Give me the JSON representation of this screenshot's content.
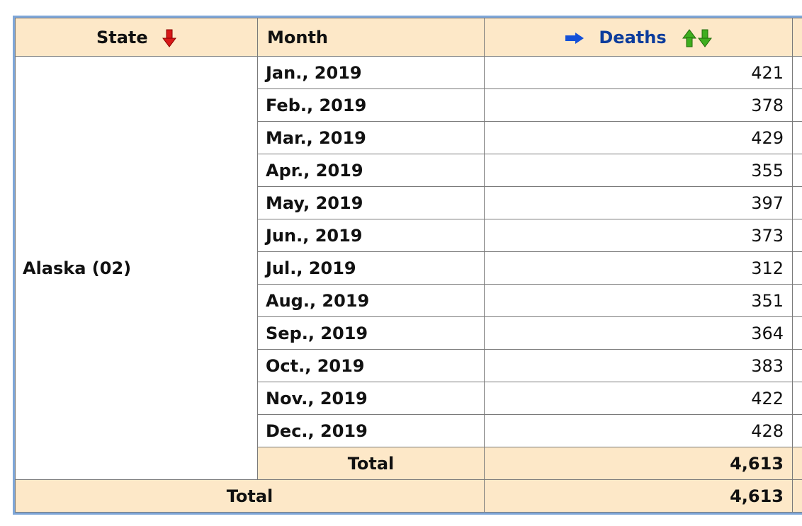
{
  "header": {
    "state": "State",
    "month": "Month",
    "deaths": "Deaths"
  },
  "icons": {
    "state_sort": "red-down-arrow-icon",
    "deaths_indicator": "blue-right-arrow-icon",
    "deaths_sort": "green-up-down-arrows-icon"
  },
  "colors": {
    "header_bg": "#fde8c8",
    "border_frame": "#7ea6d8",
    "deaths_header_text": "#0c3c9c",
    "sort_down_red": "#d81818",
    "sort_green": "#3fae1f",
    "indicator_blue": "#1450d8"
  },
  "state_label": "Alaska (02)",
  "rows": [
    {
      "month": "Jan., 2019",
      "deaths": "421"
    },
    {
      "month": "Feb., 2019",
      "deaths": "378"
    },
    {
      "month": "Mar., 2019",
      "deaths": "429"
    },
    {
      "month": "Apr., 2019",
      "deaths": "355"
    },
    {
      "month": "May, 2019",
      "deaths": "397"
    },
    {
      "month": "Jun., 2019",
      "deaths": "373"
    },
    {
      "month": "Jul., 2019",
      "deaths": "312"
    },
    {
      "month": "Aug., 2019",
      "deaths": "351"
    },
    {
      "month": "Sep., 2019",
      "deaths": "364"
    },
    {
      "month": "Oct., 2019",
      "deaths": "383"
    },
    {
      "month": "Nov., 2019",
      "deaths": "422"
    },
    {
      "month": "Dec., 2019",
      "deaths": "428"
    }
  ],
  "subtotal": {
    "label": "Total",
    "value": "4,613"
  },
  "grand_total": {
    "label": "Total",
    "value": "4,613"
  }
}
